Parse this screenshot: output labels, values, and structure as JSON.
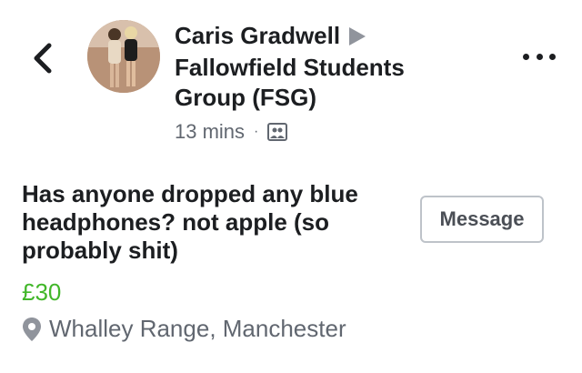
{
  "header": {
    "author": "Caris Gradwell",
    "group": "Fallowfield Students Group (FSG)",
    "time": "13 mins",
    "separator": "·"
  },
  "post": {
    "title": "Has anyone dropped any blue headphones? not apple (so probably shit)",
    "price": "£30",
    "location": "Whalley Range, Manchester",
    "message_label": "Message"
  },
  "icons": {
    "back": "chevron-left-icon",
    "arrow": "right-triangle-icon",
    "audience": "photo-icon",
    "more": "more-horizontal-icon",
    "location": "location-pin-icon"
  },
  "colors": {
    "price": "#42b72a",
    "secondary_text": "#616770",
    "button_border": "#bec3c9"
  }
}
